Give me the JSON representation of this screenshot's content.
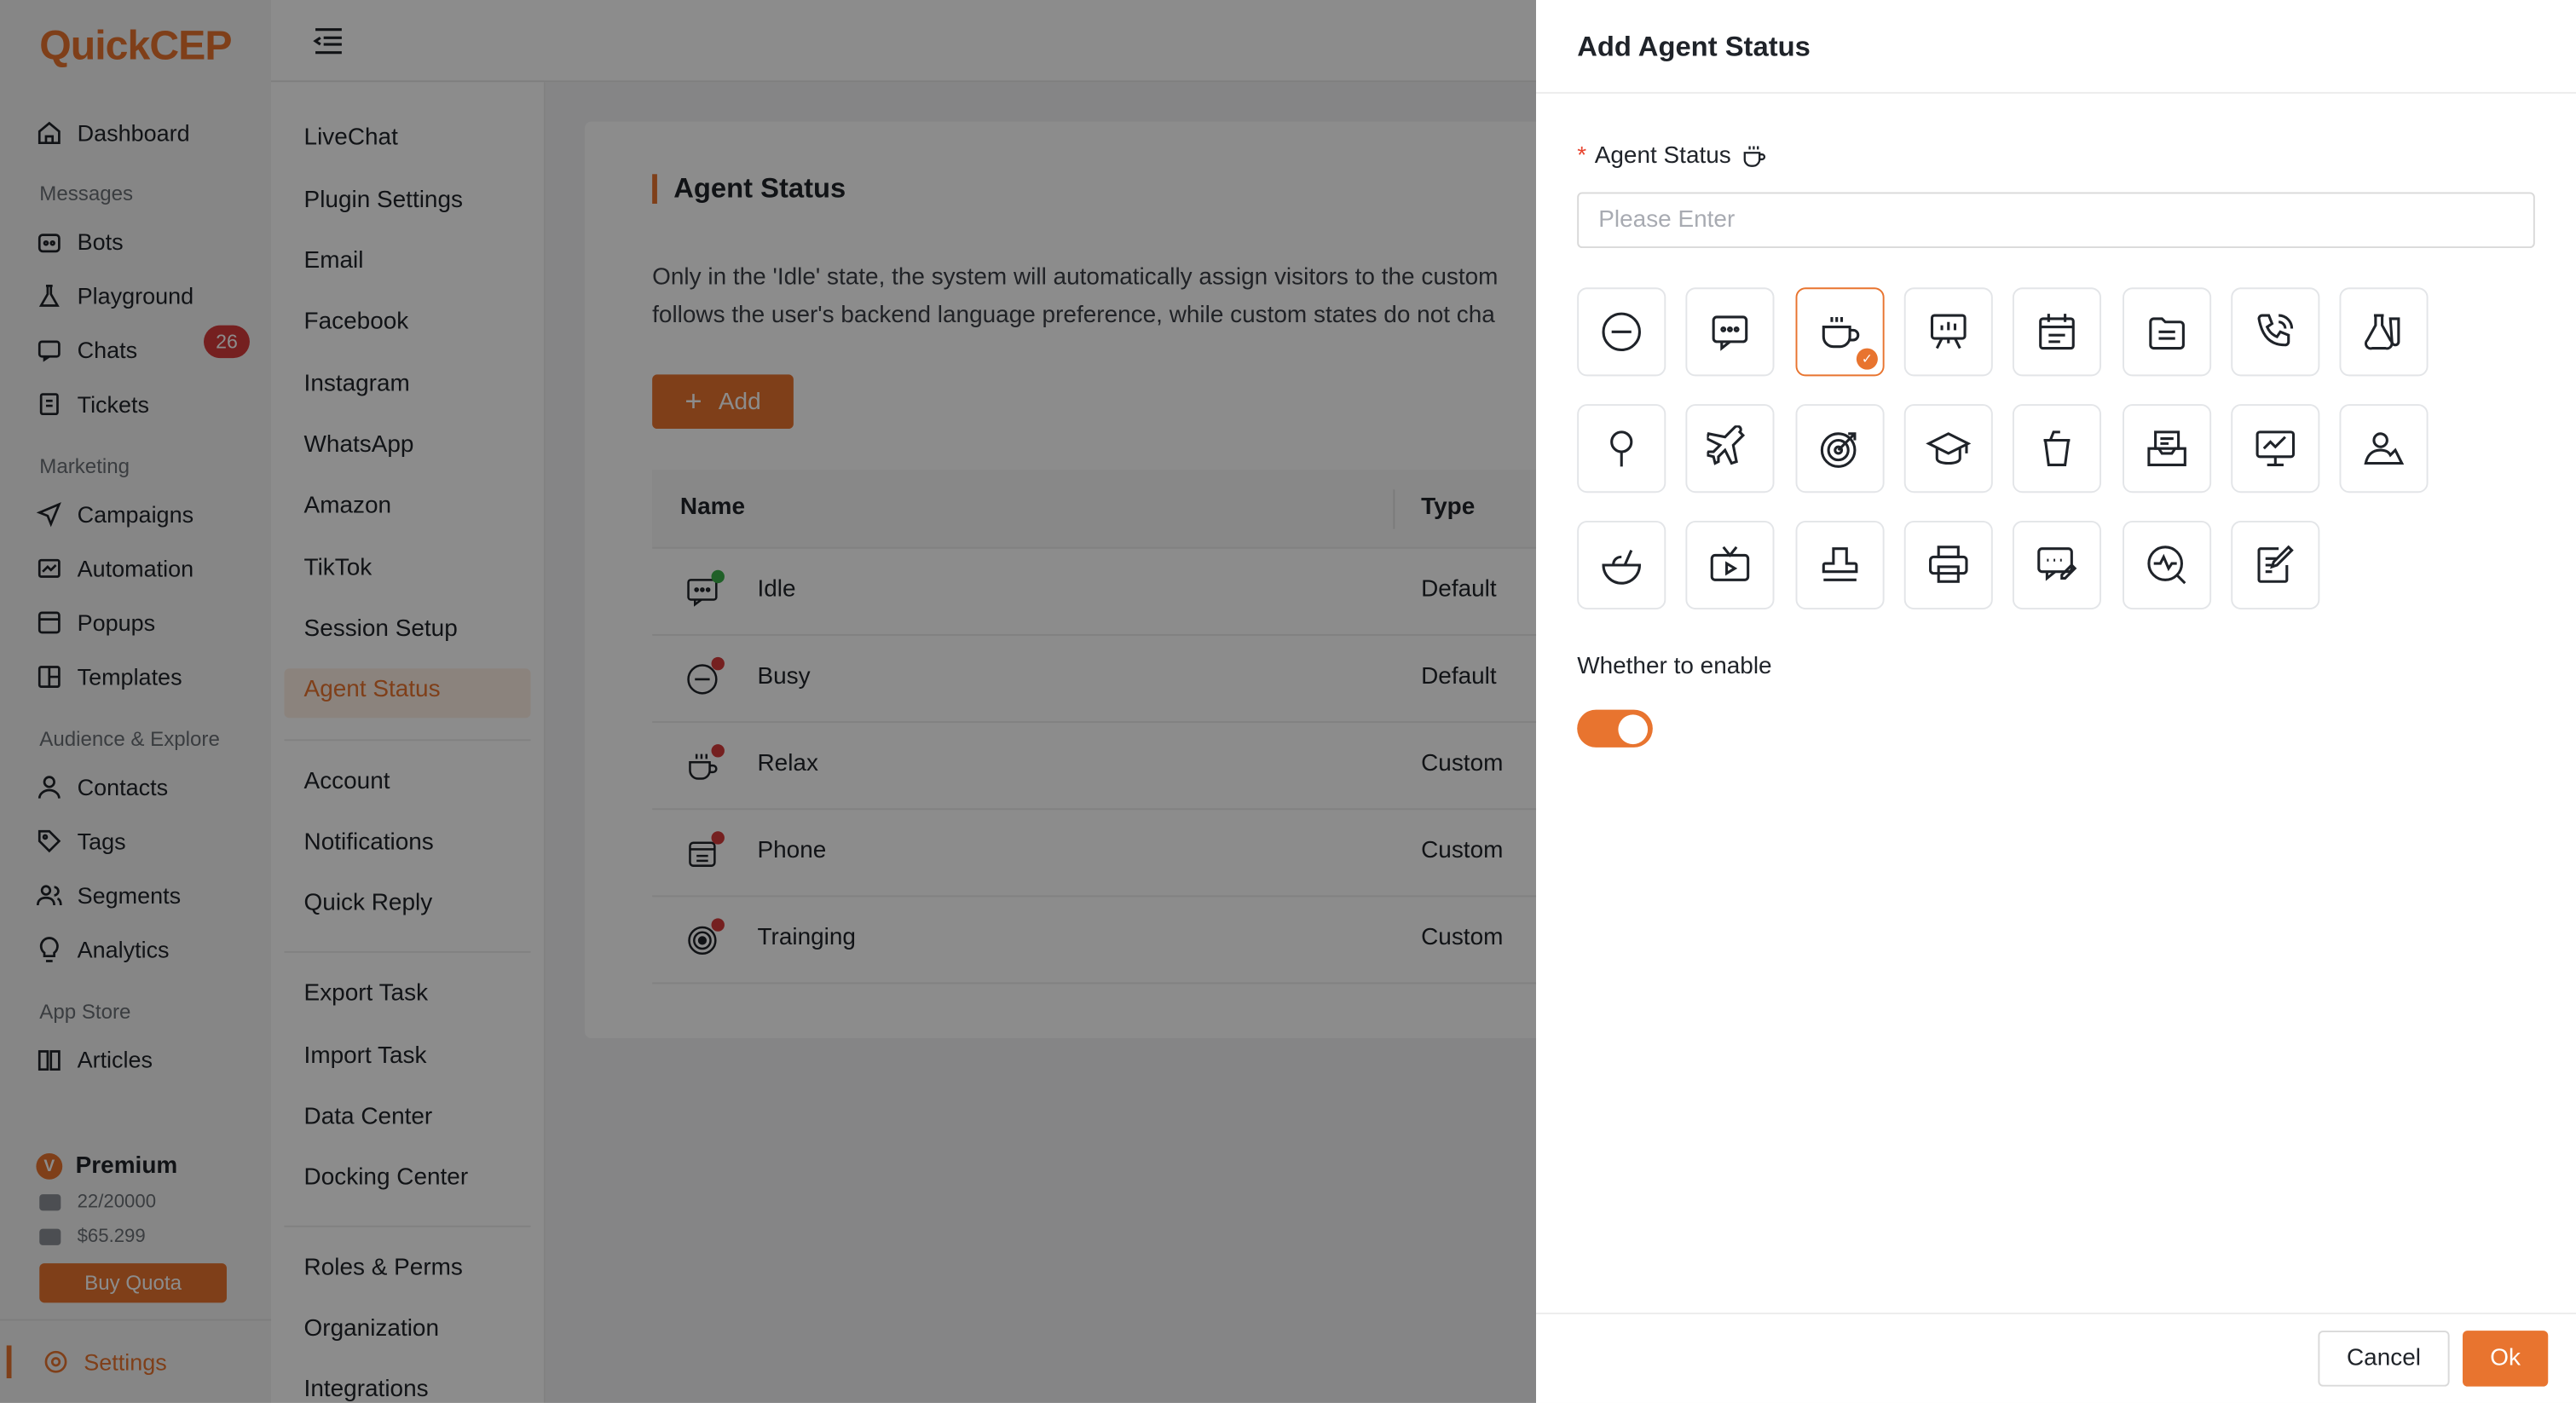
{
  "brand": {
    "logo_text_q": "Q",
    "logo_text_uick": "uick",
    "logo_text_cep": "CEP",
    "accent_color": "#e8742f"
  },
  "sidebar": {
    "dashboard": "Dashboard",
    "sections": {
      "messages": "Messages",
      "marketing": "Marketing",
      "audience": "Audience & Explore",
      "appstore": "App Store"
    },
    "items": {
      "bots": "Bots",
      "playground": "Playground",
      "chats": "Chats",
      "chats_badge": "26",
      "tickets": "Tickets",
      "campaigns": "Campaigns",
      "automation": "Automation",
      "popups": "Popups",
      "templates": "Templates",
      "contacts": "Contacts",
      "tags": "Tags",
      "segments": "Segments",
      "analytics": "Analytics",
      "articles": "Articles"
    },
    "plan": {
      "name": "Premium",
      "emails": "22/20000",
      "balance": "$65.299",
      "buy_label": "Buy Quota"
    },
    "settings": "Settings"
  },
  "submenu": {
    "group1": [
      "LiveChat",
      "Plugin Settings",
      "Email",
      "Facebook",
      "Instagram",
      "WhatsApp",
      "Amazon",
      "TikTok",
      "Session Setup",
      "Agent Status"
    ],
    "group2": [
      "Account",
      "Notifications",
      "Quick Reply"
    ],
    "group3": [
      "Export Task",
      "Import Task",
      "Data Center",
      "Docking Center"
    ],
    "group4": [
      "Roles & Perms",
      "Organization",
      "Integrations"
    ],
    "active": "Agent Status"
  },
  "main": {
    "title": "Agent Status",
    "desc_line1": "Only in the 'Idle' state, the system will automatically assign visitors to the custom",
    "desc_line2": "follows the user's backend language preference, while custom states do not cha",
    "add_label": "Add",
    "columns": {
      "name": "Name",
      "type": "Type"
    },
    "rows": [
      {
        "name": "Idle",
        "type": "Default",
        "icon": "chat-icon",
        "dot": "green"
      },
      {
        "name": "Busy",
        "type": "Default",
        "icon": "minus-circle-icon",
        "dot": "red"
      },
      {
        "name": "Relax",
        "type": "Custom",
        "icon": "coffee-icon",
        "dot": "red"
      },
      {
        "name": "Phone",
        "type": "Custom",
        "icon": "folder-icon",
        "dot": "red"
      },
      {
        "name": "Trainging",
        "type": "Custom",
        "icon": "target-icon",
        "dot": "red"
      }
    ]
  },
  "drawer": {
    "title": "Add Agent Status",
    "field_label": "Agent Status",
    "placeholder": "Please Enter",
    "icons": [
      "minus-circle-icon",
      "chat-dots-icon",
      "coffee-icon",
      "presentation-icon",
      "calendar-icon",
      "folder-icon",
      "phone-icon",
      "flask-icon",
      "pin-icon",
      "airplane-icon",
      "target-icon",
      "graduation-cap-icon",
      "cup-icon",
      "inbox-icon",
      "monitor-chart-icon",
      "user-landscape-icon",
      "bowl-icon",
      "tv-icon",
      "stamp-icon",
      "printer-icon",
      "chat-edit-icon",
      "search-pulse-icon",
      "note-edit-icon"
    ],
    "selected_icon": "coffee-icon",
    "enable_label": "Whether to enable",
    "enabled": true,
    "cancel_label": "Cancel",
    "ok_label": "Ok"
  }
}
